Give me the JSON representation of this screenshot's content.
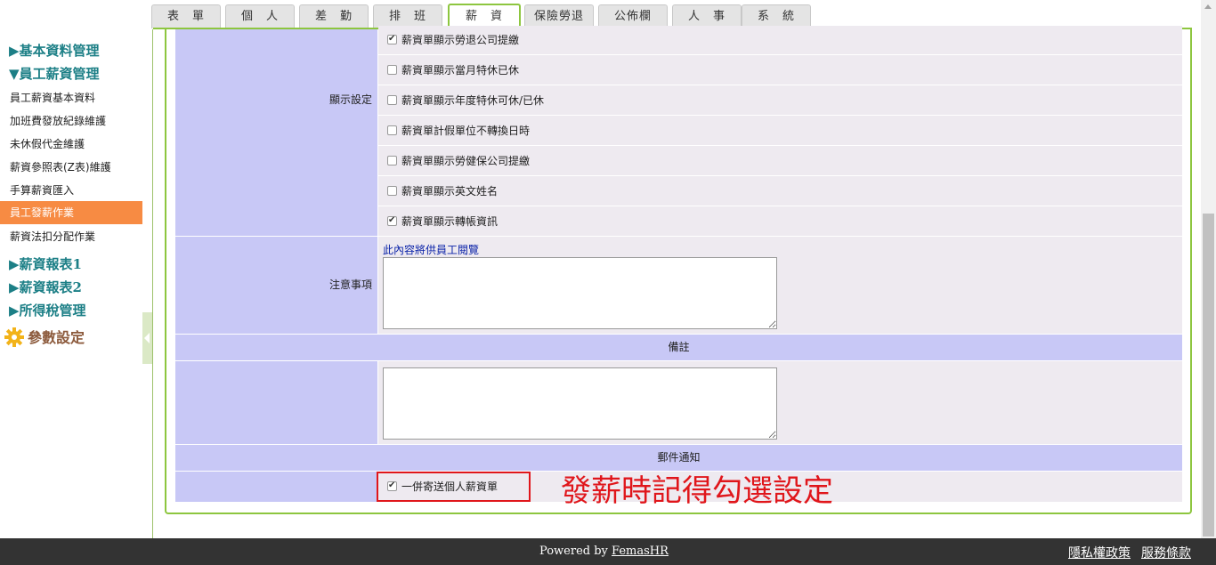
{
  "tabs": [
    {
      "label": "表　單",
      "active": false
    },
    {
      "label": "個　人",
      "active": false
    },
    {
      "label": "差　勤",
      "active": false
    },
    {
      "label": "排　班",
      "active": false
    },
    {
      "label": "薪　資",
      "active": true
    },
    {
      "label": "保險勞退",
      "active": false
    },
    {
      "label": "公佈欄",
      "active": false
    },
    {
      "label": "人　事",
      "active": false
    },
    {
      "label": "系　統",
      "active": false
    }
  ],
  "sidebar": {
    "categories": [
      "▶基本資料管理",
      "▼員工薪資管理",
      "▶薪資報表1",
      "▶薪資報表2",
      "▶所得稅管理"
    ],
    "items": [
      "員工薪資基本資料",
      "加班費發放紀錄維護",
      "未休假代金維護",
      "薪資參照表(Z表)維護",
      "手算薪資匯入",
      "員工發薪作業",
      "薪資法扣分配作業"
    ],
    "active_item": "員工發薪作業",
    "params_label": "參數設定"
  },
  "display_settings": {
    "label": "顯示設定",
    "options": [
      {
        "label": "薪資單顯示勞退公司提繳",
        "checked": true
      },
      {
        "label": "薪資單顯示當月特休已休",
        "checked": false
      },
      {
        "label": "薪資單顯示年度特休可休/已休",
        "checked": false
      },
      {
        "label": "薪資單計假單位不轉換日時",
        "checked": false
      },
      {
        "label": "薪資單顯示勞健保公司提繳",
        "checked": false
      },
      {
        "label": "薪資單顯示英文姓名",
        "checked": false
      },
      {
        "label": "薪資單顯示轉帳資訊",
        "checked": true
      }
    ]
  },
  "notes": {
    "label": "注意事項",
    "hint": "此內容將供員工閱覽",
    "value": ""
  },
  "remarks": {
    "header": "備註",
    "value": ""
  },
  "email": {
    "header": "郵件通知",
    "option_label": "一併寄送個人薪資單",
    "checked": true
  },
  "annotation": "發薪時記得勾選設定",
  "footer": {
    "powered_prefix": "Powered by ",
    "brand": "FemasHR",
    "privacy": "隱私權政策",
    "terms": "服務條款"
  },
  "colors": {
    "accent": "#8dc63f",
    "active_menu": "#f78b43",
    "label_bg": "#c8c8f6",
    "annotation": "#e0161b"
  }
}
